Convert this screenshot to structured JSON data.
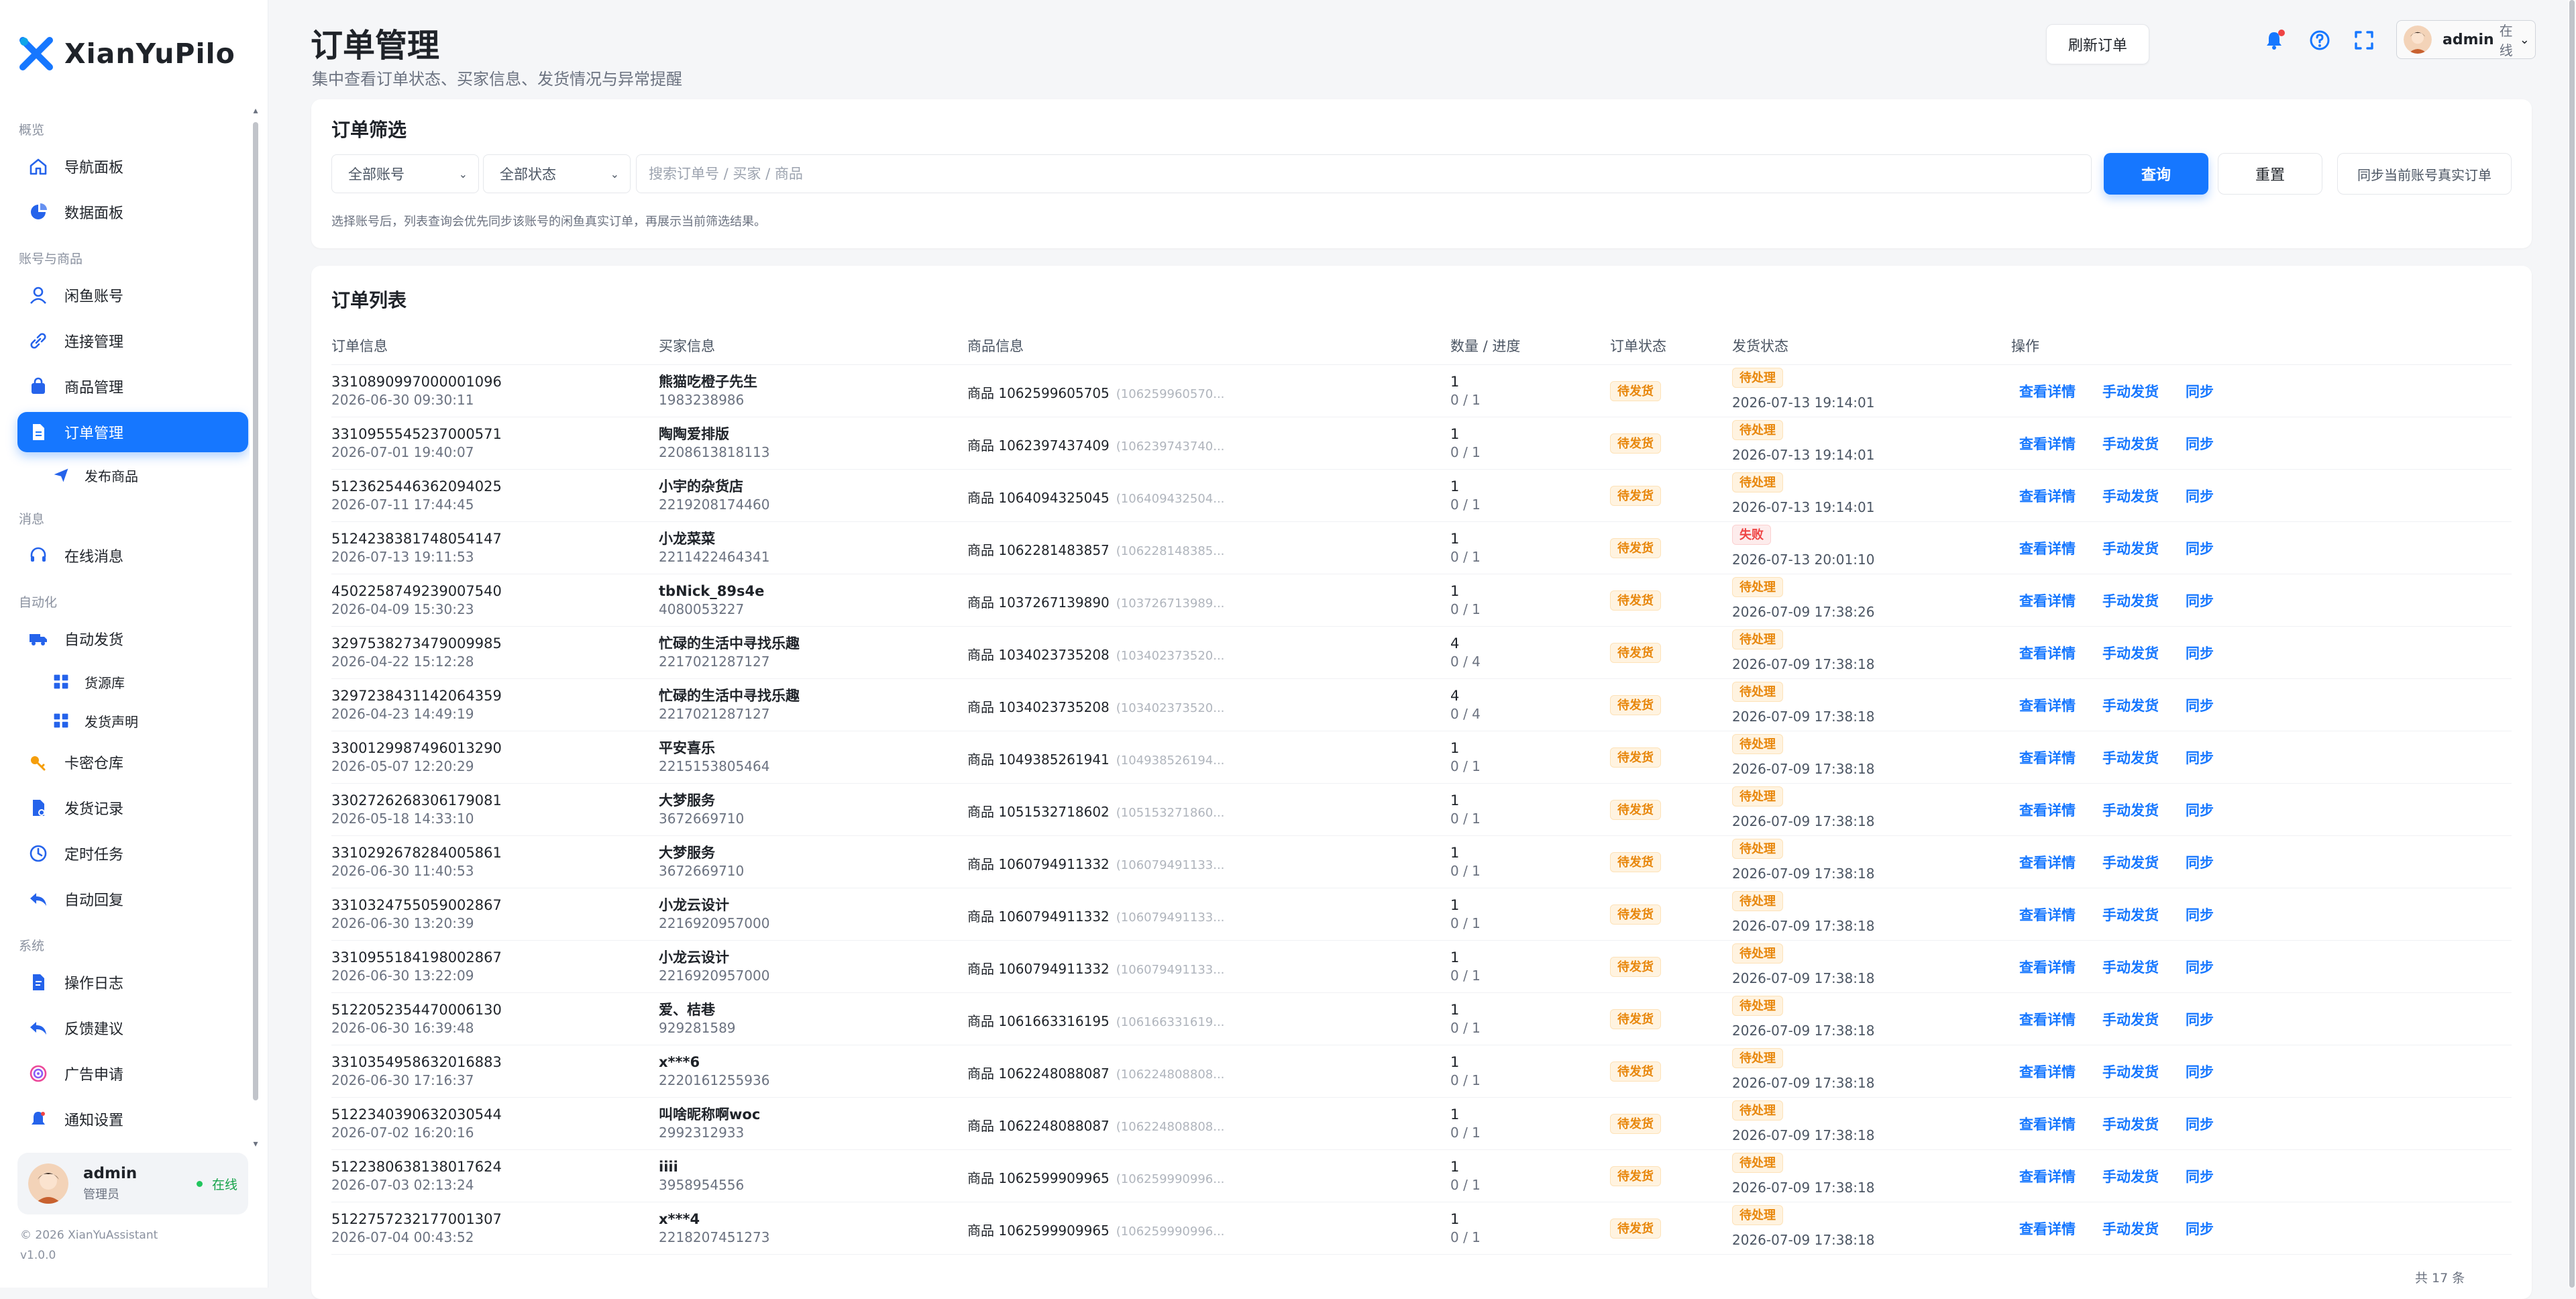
{
  "app": {
    "name": "XianYuPilo"
  },
  "sidebar": {
    "sections": [
      {
        "label": "概览",
        "items": [
          {
            "label": "导航面板",
            "icon": "home-icon"
          },
          {
            "label": "数据面板",
            "icon": "pie-chart-icon"
          }
        ]
      },
      {
        "label": "账号与商品",
        "items": [
          {
            "label": "闲鱼账号",
            "icon": "user-icon"
          },
          {
            "label": "连接管理",
            "icon": "link-icon"
          },
          {
            "label": "商品管理",
            "icon": "bag-icon"
          },
          {
            "label": "订单管理",
            "icon": "document-icon",
            "active": true
          },
          {
            "label": "发布商品",
            "icon": "send-icon",
            "sub": true
          }
        ]
      },
      {
        "label": "消息",
        "items": [
          {
            "label": "在线消息",
            "icon": "headset-icon"
          }
        ]
      },
      {
        "label": "自动化",
        "items": [
          {
            "label": "自动发货",
            "icon": "truck-icon"
          },
          {
            "label": "货源库",
            "icon": "grid-icon",
            "sub": true
          },
          {
            "label": "发货声明",
            "icon": "grid-icon",
            "sub": true
          },
          {
            "label": "卡密仓库",
            "icon": "key-icon"
          },
          {
            "label": "发货记录",
            "icon": "file-icon"
          },
          {
            "label": "定时任务",
            "icon": "clock-icon"
          },
          {
            "label": "自动回复",
            "icon": "reply-icon"
          }
        ]
      },
      {
        "label": "系统",
        "items": [
          {
            "label": "操作日志",
            "icon": "log-icon"
          },
          {
            "label": "反馈建议",
            "icon": "reply-icon"
          },
          {
            "label": "广告申请",
            "icon": "target-icon"
          },
          {
            "label": "通知设置",
            "icon": "bell-icon"
          }
        ]
      }
    ],
    "user": {
      "name": "admin",
      "role": "管理员",
      "status": "在线"
    },
    "copyright": "© 2026 XianYuAssistant",
    "version": "v1.0.0"
  },
  "header": {
    "title": "订单管理",
    "subtitle": "集中查看订单状态、买家信息、发货情况与异常提醒",
    "refresh_label": "刷新订单",
    "user_name": "admin",
    "user_status": "在线",
    "icons": [
      "bell-icon",
      "help-icon",
      "fullscreen-icon"
    ]
  },
  "filter": {
    "title": "订单筛选",
    "account_select": "全部账号",
    "status_select": "全部状态",
    "search_placeholder": "搜索订单号 / 买家 / 商品",
    "search_value": "",
    "query_label": "查询",
    "reset_label": "重置",
    "sync_label": "同步当前账号真实订单",
    "hint": "选择账号后，列表查询会优先同步该账号的闲鱼真实订单，再展示当前筛选结果。"
  },
  "list": {
    "title": "订单列表",
    "columns": [
      "订单信息",
      "买家信息",
      "商品信息",
      "数量 / 进度",
      "订单状态",
      "发货状态",
      "操作"
    ],
    "action_labels": [
      "查看详情",
      "手动发货",
      "同步"
    ],
    "total": "共 17 条",
    "rows": [
      {
        "order_no": "3310890997000001096",
        "order_time": "2026-06-30 09:30:11",
        "buyer": "熊猫吃橙子先生",
        "buyer_id": "1983238986",
        "goods": "商品 1062599605705",
        "goods_hint": "(106259960570...",
        "qty": "1",
        "progress": "0 / 1",
        "order_status": "待发货",
        "ship_status": "待处理",
        "ship_type": "warn",
        "ship_time": "2026-07-13 19:14:01"
      },
      {
        "order_no": "3310955545237000571",
        "order_time": "2026-07-01 19:40:07",
        "buyer": "陶陶爱排版",
        "buyer_id": "2208613818113",
        "goods": "商品 1062397437409",
        "goods_hint": "(106239743740...",
        "qty": "1",
        "progress": "0 / 1",
        "order_status": "待发货",
        "ship_status": "待处理",
        "ship_type": "warn",
        "ship_time": "2026-07-13 19:14:01"
      },
      {
        "order_no": "5123625446362094025",
        "order_time": "2026-07-11 17:44:45",
        "buyer": "小宇的杂货店",
        "buyer_id": "2219208174460",
        "goods": "商品 1064094325045",
        "goods_hint": "(106409432504...",
        "qty": "1",
        "progress": "0 / 1",
        "order_status": "待发货",
        "ship_status": "待处理",
        "ship_type": "warn",
        "ship_time": "2026-07-13 19:14:01"
      },
      {
        "order_no": "5124238381748054147",
        "order_time": "2026-07-13 19:11:53",
        "buyer": "小龙菜菜",
        "buyer_id": "2211422464341",
        "goods": "商品 1062281483857",
        "goods_hint": "(106228148385...",
        "qty": "1",
        "progress": "0 / 1",
        "order_status": "待发货",
        "ship_status": "失败",
        "ship_type": "fail",
        "ship_time": "2026-07-13 20:01:10"
      },
      {
        "order_no": "4502258749239007540",
        "order_time": "2026-04-09 15:30:23",
        "buyer": "tbNick_89s4e",
        "buyer_id": "4080053227",
        "goods": "商品 1037267139890",
        "goods_hint": "(103726713989...",
        "qty": "1",
        "progress": "0 / 1",
        "order_status": "待发货",
        "ship_status": "待处理",
        "ship_type": "warn",
        "ship_time": "2026-07-09 17:38:26"
      },
      {
        "order_no": "3297538273479009985",
        "order_time": "2026-04-22 15:12:28",
        "buyer": "忙碌的生活中寻找乐趣",
        "buyer_id": "2217021287127",
        "goods": "商品 1034023735208",
        "goods_hint": "(103402373520...",
        "qty": "4",
        "progress": "0 / 4",
        "order_status": "待发货",
        "ship_status": "待处理",
        "ship_type": "warn",
        "ship_time": "2026-07-09 17:38:18"
      },
      {
        "order_no": "3297238431142064359",
        "order_time": "2026-04-23 14:49:19",
        "buyer": "忙碌的生活中寻找乐趣",
        "buyer_id": "2217021287127",
        "goods": "商品 1034023735208",
        "goods_hint": "(103402373520...",
        "qty": "4",
        "progress": "0 / 4",
        "order_status": "待发货",
        "ship_status": "待处理",
        "ship_type": "warn",
        "ship_time": "2026-07-09 17:38:18"
      },
      {
        "order_no": "3300129987496013290",
        "order_time": "2026-05-07 12:20:29",
        "buyer": "平安喜乐",
        "buyer_id": "2215153805464",
        "goods": "商品 1049385261941",
        "goods_hint": "(104938526194...",
        "qty": "1",
        "progress": "0 / 1",
        "order_status": "待发货",
        "ship_status": "待处理",
        "ship_type": "warn",
        "ship_time": "2026-07-09 17:38:18"
      },
      {
        "order_no": "3302726268306179081",
        "order_time": "2026-05-18 14:33:10",
        "buyer": "大梦服务",
        "buyer_id": "3672669710",
        "goods": "商品 1051532718602",
        "goods_hint": "(105153271860...",
        "qty": "1",
        "progress": "0 / 1",
        "order_status": "待发货",
        "ship_status": "待处理",
        "ship_type": "warn",
        "ship_time": "2026-07-09 17:38:18"
      },
      {
        "order_no": "3310292678284005861",
        "order_time": "2026-06-30 11:40:53",
        "buyer": "大梦服务",
        "buyer_id": "3672669710",
        "goods": "商品 1060794911332",
        "goods_hint": "(106079491133...",
        "qty": "1",
        "progress": "0 / 1",
        "order_status": "待发货",
        "ship_status": "待处理",
        "ship_type": "warn",
        "ship_time": "2026-07-09 17:38:18"
      },
      {
        "order_no": "3310324755059002867",
        "order_time": "2026-06-30 13:20:39",
        "buyer": "小龙云设计",
        "buyer_id": "2216920957000",
        "goods": "商品 1060794911332",
        "goods_hint": "(106079491133...",
        "qty": "1",
        "progress": "0 / 1",
        "order_status": "待发货",
        "ship_status": "待处理",
        "ship_type": "warn",
        "ship_time": "2026-07-09 17:38:18"
      },
      {
        "order_no": "3310955184198002867",
        "order_time": "2026-06-30 13:22:09",
        "buyer": "小龙云设计",
        "buyer_id": "2216920957000",
        "goods": "商品 1060794911332",
        "goods_hint": "(106079491133...",
        "qty": "1",
        "progress": "0 / 1",
        "order_status": "待发货",
        "ship_status": "待处理",
        "ship_type": "warn",
        "ship_time": "2026-07-09 17:38:18"
      },
      {
        "order_no": "5122052354470006130",
        "order_time": "2026-06-30 16:39:48",
        "buyer": "爱、桔巷",
        "buyer_id": "929281589",
        "goods": "商品 1061663316195",
        "goods_hint": "(106166331619...",
        "qty": "1",
        "progress": "0 / 1",
        "order_status": "待发货",
        "ship_status": "待处理",
        "ship_type": "warn",
        "ship_time": "2026-07-09 17:38:18"
      },
      {
        "order_no": "3310354958632016883",
        "order_time": "2026-06-30 17:16:37",
        "buyer": "x***6",
        "buyer_id": "2220161255936",
        "goods": "商品 1062248088087",
        "goods_hint": "(106224808808...",
        "qty": "1",
        "progress": "0 / 1",
        "order_status": "待发货",
        "ship_status": "待处理",
        "ship_type": "warn",
        "ship_time": "2026-07-09 17:38:18"
      },
      {
        "order_no": "5122340390632030544",
        "order_time": "2026-07-02 16:20:16",
        "buyer": "叫啥昵称啊woc",
        "buyer_id": "2992312933",
        "goods": "商品 1062248088087",
        "goods_hint": "(106224808808...",
        "qty": "1",
        "progress": "0 / 1",
        "order_status": "待发货",
        "ship_status": "待处理",
        "ship_type": "warn",
        "ship_time": "2026-07-09 17:38:18"
      },
      {
        "order_no": "5122380638138017624",
        "order_time": "2026-07-03 02:13:24",
        "buyer": "iiii",
        "buyer_id": "3958954556",
        "goods": "商品 1062599909965",
        "goods_hint": "(106259990996...",
        "qty": "1",
        "progress": "0 / 1",
        "order_status": "待发货",
        "ship_status": "待处理",
        "ship_type": "warn",
        "ship_time": "2026-07-09 17:38:18"
      },
      {
        "order_no": "5122757232177001307",
        "order_time": "2026-07-04 00:43:52",
        "buyer": "x***4",
        "buyer_id": "2218207451273",
        "goods": "商品 1062599909965",
        "goods_hint": "(106259990996...",
        "qty": "1",
        "progress": "0 / 1",
        "order_status": "待发货",
        "ship_status": "待处理",
        "ship_type": "warn",
        "ship_time": "2026-07-09 17:38:18"
      }
    ]
  },
  "colors": {
    "primary": "#1677ff",
    "warning": "#e8870c",
    "danger": "#ef4444",
    "success": "#22c55e"
  }
}
